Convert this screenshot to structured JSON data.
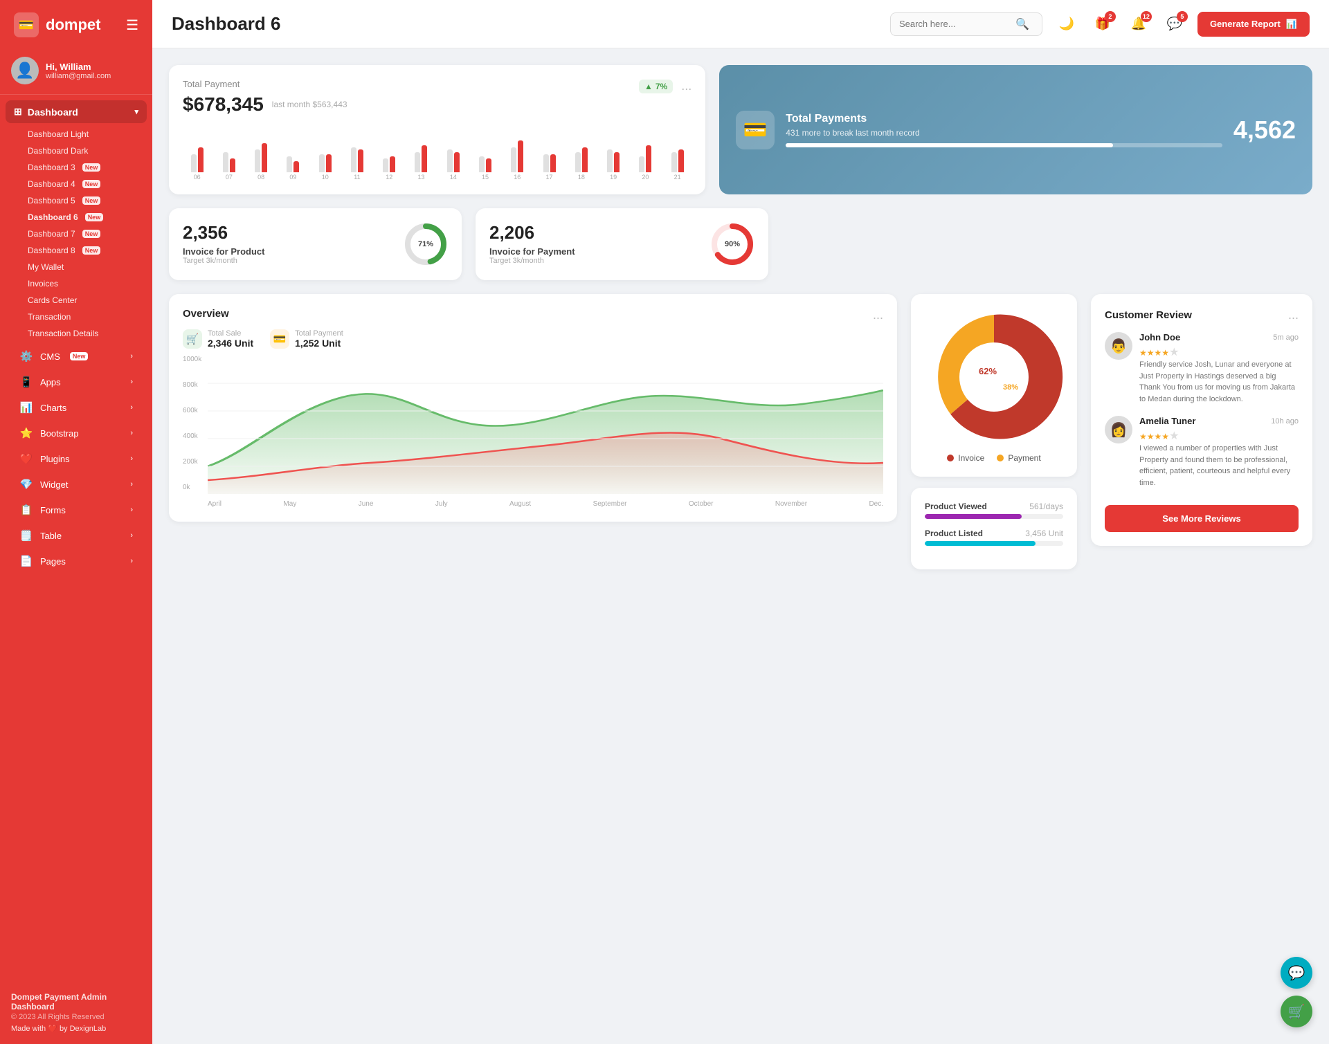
{
  "sidebar": {
    "logo": "dompet",
    "logo_icon": "💳",
    "hamburger": "☰",
    "profile": {
      "greeting": "Hi, William",
      "email": "william@gmail.com",
      "avatar": "👤"
    },
    "dashboard_menu": {
      "label": "Dashboard",
      "icon": "⊞",
      "items": [
        {
          "label": "Dashboard Light",
          "badge": null,
          "active": false
        },
        {
          "label": "Dashboard Dark",
          "badge": null,
          "active": false
        },
        {
          "label": "Dashboard 3",
          "badge": "New",
          "active": false
        },
        {
          "label": "Dashboard 4",
          "badge": "New",
          "active": false
        },
        {
          "label": "Dashboard 5",
          "badge": "New",
          "active": false
        },
        {
          "label": "Dashboard 6",
          "badge": "New",
          "active": true
        },
        {
          "label": "Dashboard 7",
          "badge": "New",
          "active": false
        },
        {
          "label": "Dashboard 8",
          "badge": "New",
          "active": false
        },
        {
          "label": "My Wallet",
          "badge": null,
          "active": false
        },
        {
          "label": "Invoices",
          "badge": null,
          "active": false
        },
        {
          "label": "Cards Center",
          "badge": null,
          "active": false
        },
        {
          "label": "Transaction",
          "badge": null,
          "active": false
        },
        {
          "label": "Transaction Details",
          "badge": null,
          "active": false
        }
      ]
    },
    "nav_items": [
      {
        "label": "CMS",
        "icon": "⚙️",
        "badge": "New",
        "arrow": true
      },
      {
        "label": "Apps",
        "icon": "📱",
        "badge": null,
        "arrow": true
      },
      {
        "label": "Charts",
        "icon": "📊",
        "badge": null,
        "arrow": true
      },
      {
        "label": "Bootstrap",
        "icon": "⭐",
        "badge": null,
        "arrow": true
      },
      {
        "label": "Plugins",
        "icon": "❤️",
        "badge": null,
        "arrow": true
      },
      {
        "label": "Widget",
        "icon": "💎",
        "badge": null,
        "arrow": true
      },
      {
        "label": "Forms",
        "icon": "📋",
        "badge": null,
        "arrow": true
      },
      {
        "label": "Table",
        "icon": "🗒️",
        "badge": null,
        "arrow": true
      },
      {
        "label": "Pages",
        "icon": "📄",
        "badge": null,
        "arrow": true
      }
    ],
    "footer": {
      "title": "Dompet Payment Admin Dashboard",
      "copy": "© 2023 All Rights Reserved",
      "made": "Made with ❤️ by DexignLab"
    }
  },
  "header": {
    "title": "Dashboard 6",
    "search_placeholder": "Search here...",
    "icons": {
      "moon": "🌙",
      "gift_badge": "2",
      "bell_badge": "12",
      "chat_badge": "5"
    },
    "generate_btn": "Generate Report"
  },
  "total_payment": {
    "title": "Total Payment",
    "amount": "$678,345",
    "last_month_label": "last month $563,443",
    "trend": "7%",
    "trend_arrow": "▲",
    "more": "...",
    "bars": [
      {
        "gray": 40,
        "red": 55,
        "label": "06"
      },
      {
        "gray": 45,
        "red": 30,
        "label": "07"
      },
      {
        "gray": 50,
        "red": 65,
        "label": "08"
      },
      {
        "gray": 35,
        "red": 25,
        "label": "09"
      },
      {
        "gray": 40,
        "red": 40,
        "label": "10"
      },
      {
        "gray": 55,
        "red": 50,
        "label": "11"
      },
      {
        "gray": 30,
        "red": 35,
        "label": "12"
      },
      {
        "gray": 45,
        "red": 60,
        "label": "13"
      },
      {
        "gray": 50,
        "red": 45,
        "label": "14"
      },
      {
        "gray": 35,
        "red": 30,
        "label": "15"
      },
      {
        "gray": 55,
        "red": 70,
        "label": "16"
      },
      {
        "gray": 40,
        "red": 40,
        "label": "17"
      },
      {
        "gray": 45,
        "red": 55,
        "label": "18"
      },
      {
        "gray": 50,
        "red": 45,
        "label": "19"
      },
      {
        "gray": 35,
        "red": 60,
        "label": "20"
      },
      {
        "gray": 45,
        "red": 50,
        "label": "21"
      }
    ]
  },
  "total_payments_banner": {
    "title": "Total Payments",
    "subtitle": "431 more to break last month record",
    "value": "4,562",
    "bar_fill": "75%",
    "icon": "💳"
  },
  "invoice_product": {
    "value": "2,356",
    "label": "Invoice for Product",
    "sub": "Target 3k/month",
    "percent": 71,
    "color": "#43a047"
  },
  "invoice_payment": {
    "value": "2,206",
    "label": "Invoice for Payment",
    "sub": "Target 3k/month",
    "percent": 90,
    "color": "#e53935"
  },
  "overview": {
    "title": "Overview",
    "more": "...",
    "total_sale": {
      "label": "Total Sale",
      "value": "2,346 Unit",
      "icon": "🛒",
      "color": "#43a047"
    },
    "total_payment": {
      "label": "Total Payment",
      "value": "1,252 Unit",
      "icon": "💳",
      "color": "#ff7043"
    },
    "y_labels": [
      "1000k",
      "800k",
      "600k",
      "400k",
      "200k",
      "0k"
    ],
    "x_labels": [
      "April",
      "May",
      "June",
      "July",
      "August",
      "September",
      "October",
      "November",
      "Dec."
    ]
  },
  "pie_chart": {
    "invoice_pct": 62,
    "payment_pct": 38,
    "invoice_label": "Invoice",
    "payment_label": "Payment",
    "invoice_color": "#c0392b",
    "payment_color": "#f5a623"
  },
  "product_stats": {
    "product_viewed": {
      "label": "Product Viewed",
      "value": "561/days",
      "fill": 70,
      "color": "#9c27b0"
    },
    "product_listed": {
      "label": "Product Listed",
      "value": "3,456 Unit",
      "fill": 80,
      "color": "#00bcd4"
    }
  },
  "customer_review": {
    "title": "Customer Review",
    "more": "...",
    "reviews": [
      {
        "name": "John Doe",
        "stars": 4,
        "time": "5m ago",
        "text": "Friendly service Josh, Lunar and everyone at Just Property in Hastings deserved a big Thank You from us for moving us from Jakarta to Medan during the lockdown.",
        "avatar": "👨"
      },
      {
        "name": "Amelia Tuner",
        "stars": 4,
        "time": "10h ago",
        "text": "I viewed a number of properties with Just Property and found them to be professional, efficient, patient, courteous and helpful every time.",
        "avatar": "👩"
      }
    ],
    "btn_more": "See More Reviews"
  },
  "fab": {
    "support": "💬",
    "cart": "🛒"
  }
}
